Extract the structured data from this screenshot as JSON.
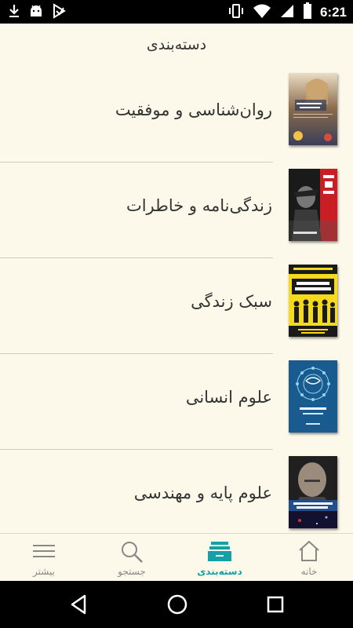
{
  "status_bar": {
    "time": "6:21",
    "left_icons": [
      "download-icon",
      "android-icon",
      "play-store-icon"
    ],
    "right_icons": [
      "vibrate-icon",
      "wifi-icon",
      "signal-icon",
      "battery-icon"
    ]
  },
  "header": {
    "title": "دسته‌بندی"
  },
  "categories": [
    {
      "label": "روان‌شناسی و موفقیت",
      "cover_text": "خوب بودن دختر"
    },
    {
      "label": "زندگی‌نامه و خاطرات",
      "cover_text": "سرتیز"
    },
    {
      "label": "سبک زندگی",
      "cover_text": "کتاب جامع اسرار زبان بدن"
    },
    {
      "label": "علوم انسانی",
      "cover_text": ""
    },
    {
      "label": "علوم پایه و مهندسی",
      "cover_text": "جهان در پوست گردو"
    }
  ],
  "bottom_nav": {
    "more": "بیشتر",
    "search": "جستجو",
    "categories": "دسته‌بندی",
    "home": "خانه",
    "active": "categories",
    "active_color": "#15a0a8"
  },
  "colors": {
    "background": "#fdf9ea",
    "accent": "#15a0a8"
  }
}
